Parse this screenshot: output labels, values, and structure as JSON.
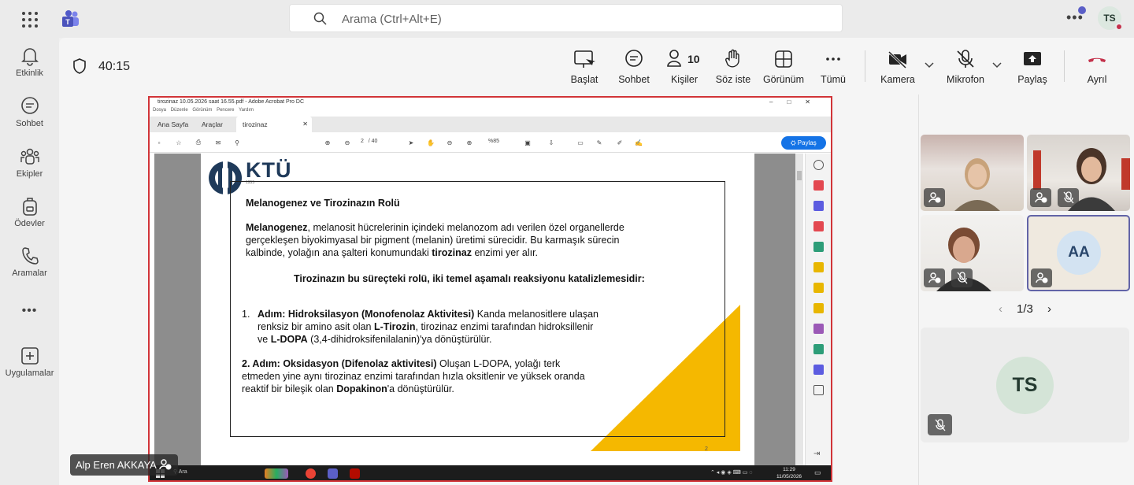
{
  "topbar": {
    "search_placeholder": "Arama (Ctrl+Alt+E)",
    "user_initials": "TS",
    "accent": "#5b5fc7"
  },
  "rail": {
    "items": [
      {
        "label": "Etkinlik",
        "icon": "bell-icon"
      },
      {
        "label": "Sohbet",
        "icon": "chat-icon"
      },
      {
        "label": "Ekipler",
        "icon": "teams-icon"
      },
      {
        "label": "Ödevler",
        "icon": "backpack-icon"
      },
      {
        "label": "Aramalar",
        "icon": "phone-icon"
      },
      {
        "label": "...",
        "icon": "more-icon"
      },
      {
        "label": "Uygulamalar",
        "icon": "add-apps-icon"
      }
    ]
  },
  "meeting": {
    "timer": "40:15",
    "toolbar": {
      "baslat": "Başlat",
      "sohbet": "Sohbet",
      "kisiler": "Kişiler",
      "kisiler_count": "10",
      "soz_iste": "Söz iste",
      "gorunum": "Görünüm",
      "tumu": "Tümü",
      "kamera": "Kamera",
      "mikrofon": "Mikrofon",
      "paylas": "Paylaş",
      "ayril": "Ayrıl"
    }
  },
  "acrobat": {
    "window_title": "tirozinaz 10.05.2026 saat 16.55.pdf - Adobe Acrobat Pro DC",
    "menu": [
      "Dosya",
      "Düzenle",
      "Görünüm",
      "Pencere",
      "Yardım"
    ],
    "tabs": [
      "Ana Sayfa",
      "Araçlar",
      "tirozinaz 10.05.2026..."
    ],
    "page_current": "2",
    "page_total": "/ 40",
    "zoom": "%85",
    "share_label": "Paylaş"
  },
  "slide": {
    "logo_text": "KTÜ",
    "logo_year": "1955",
    "title": "Melanogenez ve Tirozinazın Rolü",
    "para_bold": "Melanogenez",
    "para_1": ", melanosit hücrelerinin içindeki melanozom adı verilen özel organellerde gerçekleşen biyokimyasal bir pigment (melanin) üretimi sürecidir. Bu karmaşık sürecin kalbinde, yolağın ana şalteri konumundaki ",
    "para_bold2": "tirozinaz",
    "para_2": " enzimi yer alır.",
    "center_heading": "Tirozinazın bu süreçteki rolü, iki temel aşamalı reaksiyonu katalizlemesidir:",
    "step1_num": "1.",
    "step1_bold": "Adım: Hidroksilasyon (Monofenolaz Aktivitesi)",
    "step1_a": " Kanda melanositlere ulaşan renksiz bir amino asit olan ",
    "step1_bold2": "L-Tirozin",
    "step1_b": ", tirozinaz enzimi tarafından hidroksillenir ve ",
    "step1_bold3": "L-DOPA",
    "step1_c": " (3,4-dihidroksifenilalanin)'ya dönüştürülür.",
    "step2_bold": "2. Adım: Oksidasyon (Difenolaz aktivitesi)",
    "step2_a": " Oluşan L-DOPA, yolağı terk etmeden yine aynı tirozinaz enzimi tarafından hızla oksitlenir ve yüksek oranda reaktif bir bileşik olan ",
    "step2_bold2": "Dopakinon",
    "step2_b": "'a dönüştürülür.",
    "page_number": "2",
    "accent_yellow": "#f5b800"
  },
  "windows_taskbar": {
    "search": "Ara",
    "time": "11:29",
    "date": "11/05/2026"
  },
  "presenter": {
    "name": "Alp Eren AKKAYA"
  },
  "participants": {
    "aa_initials": "AA",
    "ts_initials": "TS",
    "pager": "1/3"
  }
}
